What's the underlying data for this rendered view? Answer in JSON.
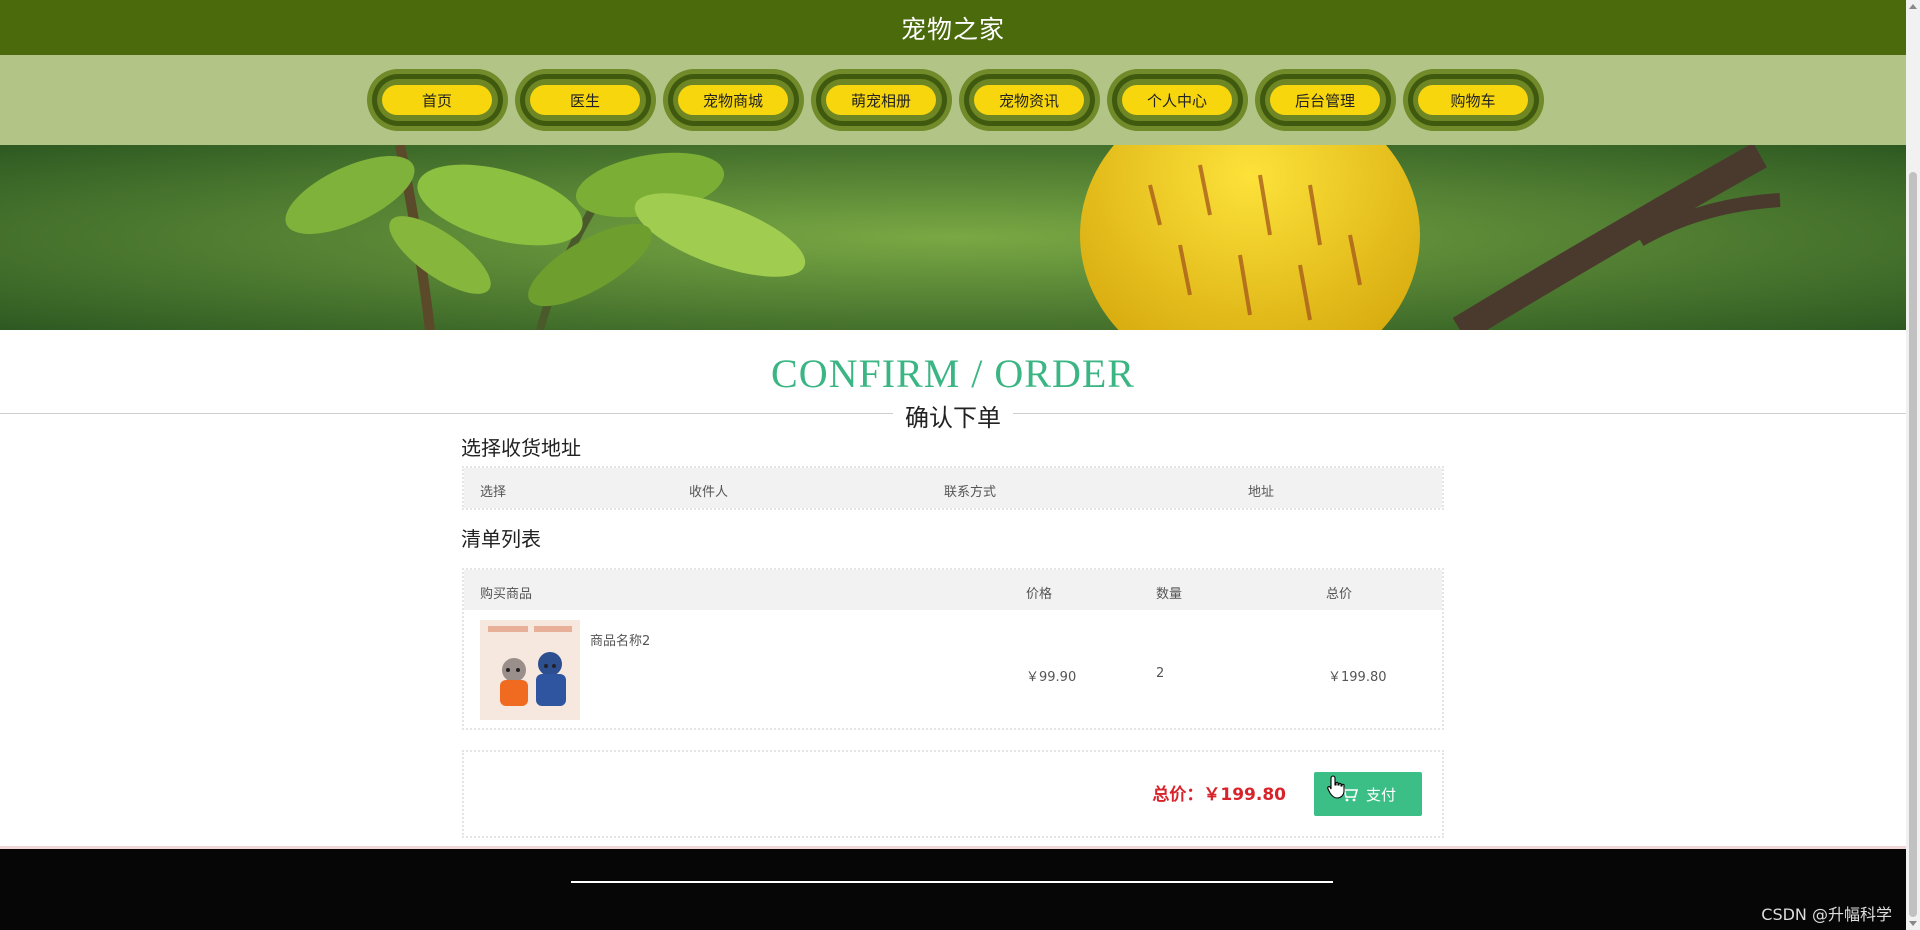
{
  "site": {
    "title": "宠物之家"
  },
  "nav": {
    "items": [
      {
        "label": "首页"
      },
      {
        "label": "医生"
      },
      {
        "label": "宠物商城"
      },
      {
        "label": "萌宠相册"
      },
      {
        "label": "宠物资讯"
      },
      {
        "label": "个人中心"
      },
      {
        "label": "后台管理"
      },
      {
        "label": "购物车"
      }
    ]
  },
  "heading": {
    "en": "CONFIRM / ORDER",
    "cn": "确认下单"
  },
  "address_section": {
    "title": "选择收货地址",
    "columns": [
      "选择",
      "收件人",
      "联系方式",
      "地址"
    ]
  },
  "list_section": {
    "title": "清单列表",
    "columns": [
      "购买商品",
      "价格",
      "数量",
      "总价"
    ],
    "rows": [
      {
        "name": "商品名称2",
        "price": "￥99.90",
        "quantity": "2",
        "total": "￥199.80"
      }
    ]
  },
  "summary": {
    "total_label": "总价：",
    "total_value": "￥199.80",
    "pay_label": "支付"
  },
  "watermark": "CSDN @升幅科学",
  "colors": {
    "topbar": "#4a6a0c",
    "navbar": "#b3c487",
    "nav_pill": "#f7d60e",
    "heading_en": "#3ab583",
    "pay_button": "#3bbf86",
    "total_text": "#d8232a",
    "footer": "#060606"
  },
  "icons": {
    "pay": "cart-icon",
    "cursor": "hand-pointer-icon"
  }
}
